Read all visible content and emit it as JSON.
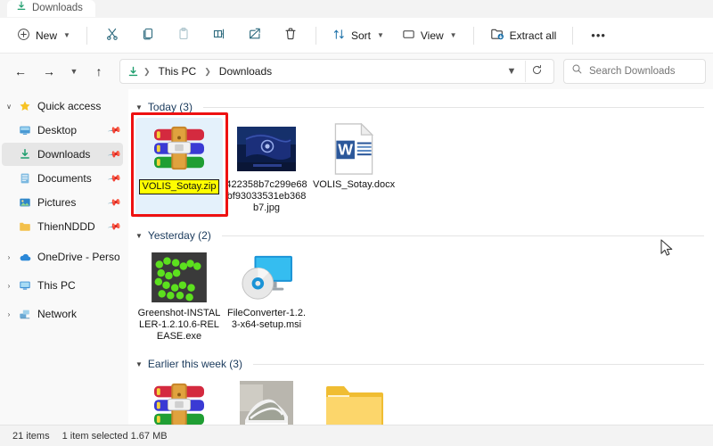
{
  "window": {
    "tab_label": "Downloads",
    "tab_icon": "downloads-icon"
  },
  "toolbar": {
    "new_label": "New",
    "new_icon": "plus-circle-icon",
    "cut_icon": "scissors-icon",
    "copy_icon": "copy-icon",
    "paste_icon": "clipboard-icon",
    "rename_icon": "rename-icon",
    "share_icon": "share-icon",
    "delete_icon": "trash-icon",
    "sort_label": "Sort",
    "sort_icon": "sort-arrows-icon",
    "view_label": "View",
    "view_icon": "monitor-icon",
    "extract_label": "Extract all",
    "extract_icon": "extract-folder-icon",
    "more_label": "•••"
  },
  "address": {
    "back_icon": "arrow-left-icon",
    "forward_icon": "arrow-right-icon",
    "recent_icon": "chevron-down-icon",
    "up_icon": "arrow-up-icon",
    "path_icon": "downloads-icon",
    "crumbs": [
      "This PC",
      "Downloads"
    ],
    "dropdown_icon": "chevron-down-icon",
    "refresh_icon": "refresh-icon"
  },
  "search": {
    "placeholder": "Search Downloads",
    "icon": "search-icon"
  },
  "sidebar": {
    "items": [
      {
        "label": "Quick access",
        "icon": "star-icon",
        "expander": "∨",
        "pinned": false,
        "selected": false,
        "child": false
      },
      {
        "label": "Desktop",
        "icon": "desktop-icon",
        "expander": "",
        "pinned": true,
        "selected": false,
        "child": true
      },
      {
        "label": "Downloads",
        "icon": "downloads-icon",
        "expander": "",
        "pinned": true,
        "selected": true,
        "child": true
      },
      {
        "label": "Documents",
        "icon": "documents-icon",
        "expander": "",
        "pinned": true,
        "selected": false,
        "child": true
      },
      {
        "label": "Pictures",
        "icon": "pictures-icon",
        "expander": "",
        "pinned": true,
        "selected": false,
        "child": true
      },
      {
        "label": "ThienNDDD",
        "icon": "folder-icon",
        "expander": "",
        "pinned": true,
        "selected": false,
        "child": true
      },
      {
        "label": "OneDrive - Personal",
        "icon": "cloud-icon",
        "expander": "›",
        "pinned": false,
        "selected": false,
        "child": false
      },
      {
        "label": "This PC",
        "icon": "pc-icon",
        "expander": "›",
        "pinned": false,
        "selected": false,
        "child": false
      },
      {
        "label": "Network",
        "icon": "network-icon",
        "expander": "›",
        "pinned": false,
        "selected": false,
        "child": false
      }
    ]
  },
  "groups": [
    {
      "title": "Today (3)",
      "files": [
        {
          "name": "VOLIS_Sotay.zip",
          "icon": "winrar-archive-icon",
          "selected": true,
          "highlighted": true
        },
        {
          "name": "422358b7c299e68bf93033531eb368b7.jpg",
          "icon": "image-thumbnail-flag",
          "selected": false,
          "highlighted": false
        },
        {
          "name": "VOLIS_Sotay.docx",
          "icon": "word-document-icon",
          "selected": false,
          "highlighted": false
        }
      ]
    },
    {
      "title": "Yesterday (2)",
      "files": [
        {
          "name": "Greenshot-INSTALLER-1.2.10.6-RELEASE.exe",
          "icon": "greenshot-icon",
          "selected": false,
          "highlighted": false
        },
        {
          "name": "FileConverter-1.2.3-x64-setup.msi",
          "icon": "fileconverter-icon",
          "selected": false,
          "highlighted": false
        }
      ]
    },
    {
      "title": "Earlier this week (3)",
      "files": [
        {
          "name": "",
          "icon": "winrar-archive-icon",
          "selected": false,
          "highlighted": false
        },
        {
          "name": "",
          "icon": "image-thumbnail-shoe",
          "selected": false,
          "highlighted": false
        },
        {
          "name": "",
          "icon": "folder-icon-large",
          "selected": false,
          "highlighted": false
        }
      ]
    }
  ],
  "status": {
    "item_count": "21 items",
    "selection": "1 item selected  1.67 MB"
  },
  "annotation": {
    "color": "#ee1111"
  }
}
